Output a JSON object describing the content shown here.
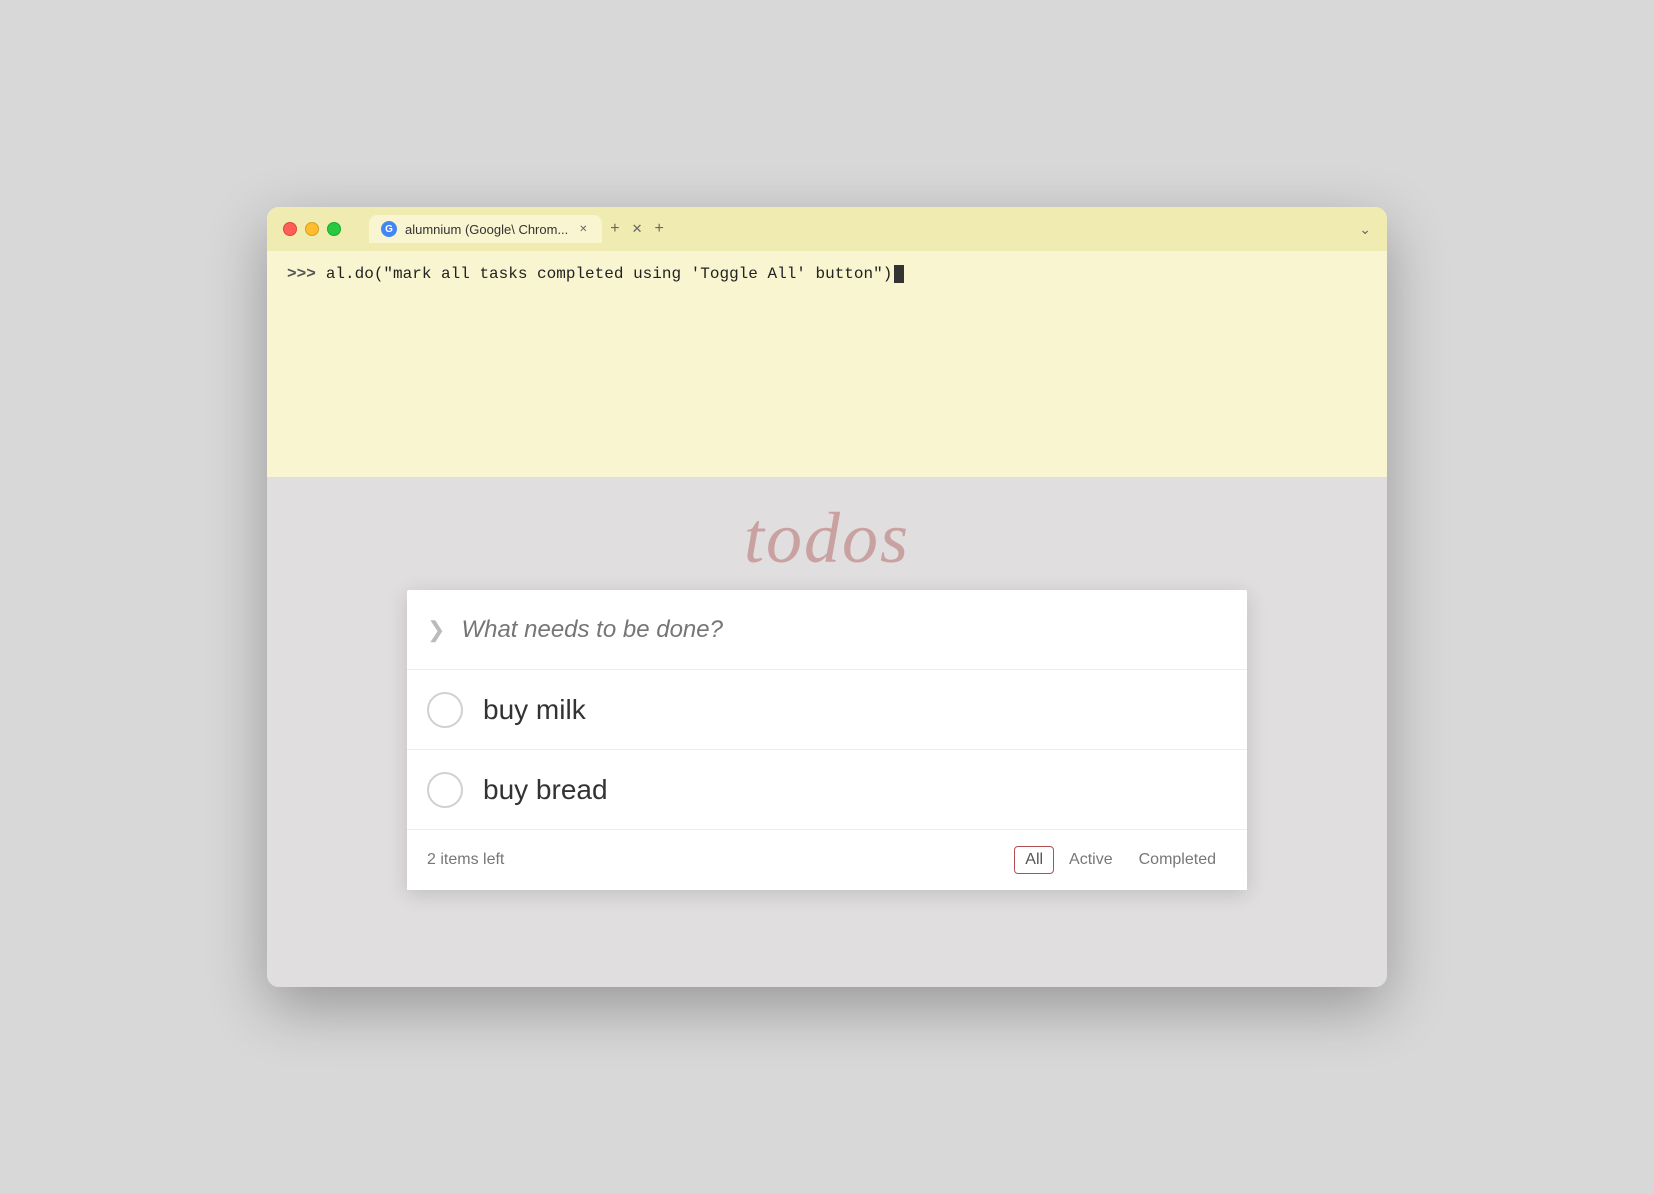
{
  "browser": {
    "tab_label": "alumnium (Google\\ Chrom...",
    "tab_icon": "G"
  },
  "terminal": {
    "prompt": ">>>",
    "command": "al.do(\"mark all tasks completed using 'Toggle All' button\")"
  },
  "todo": {
    "title": "todos",
    "input_placeholder": "What needs to be done?",
    "toggle_all_chevron": "❯",
    "items": [
      {
        "id": 1,
        "text": "buy milk",
        "completed": false
      },
      {
        "id": 2,
        "text": "buy bread",
        "completed": false
      }
    ],
    "items_left_label": "2 items left",
    "filters": [
      {
        "label": "All",
        "active": true
      },
      {
        "label": "Active",
        "active": false
      },
      {
        "label": "Completed",
        "active": false
      }
    ]
  }
}
